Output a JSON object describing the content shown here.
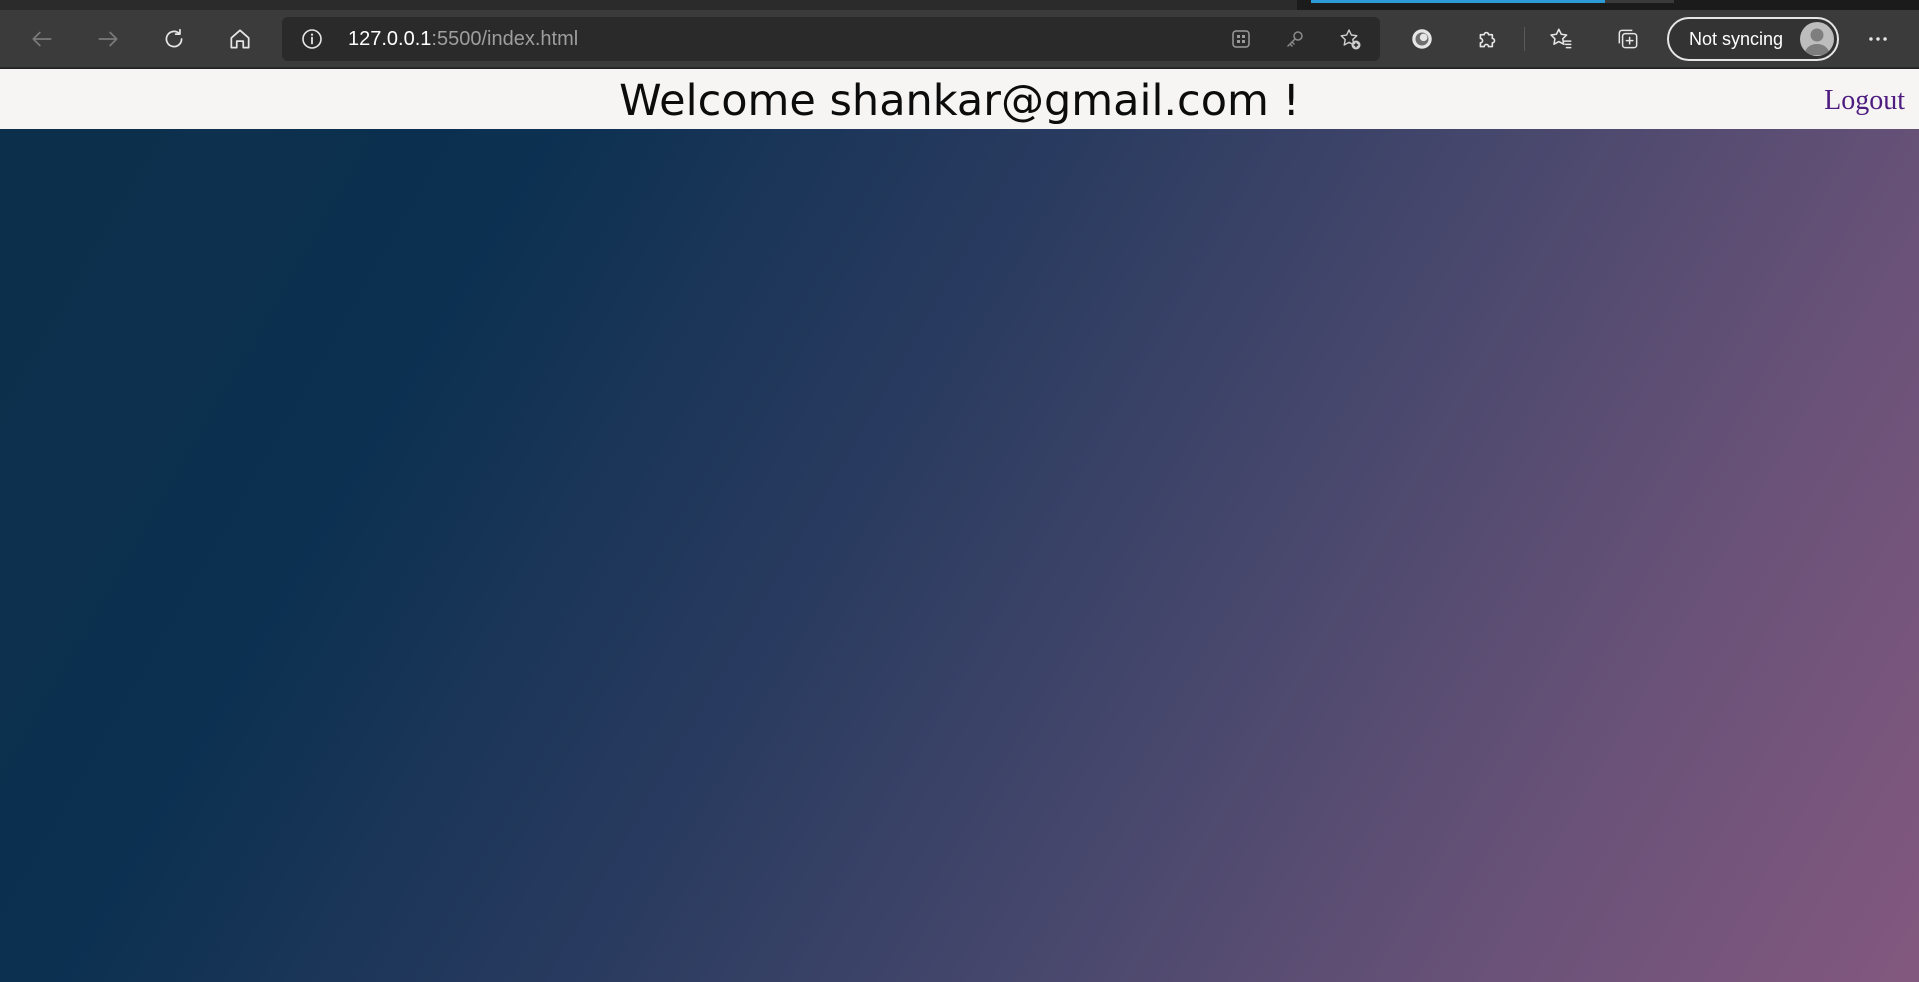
{
  "browser": {
    "url_host": "127.0.0.1",
    "url_path": ":5500/index.html",
    "sync_label": "Not syncing",
    "icons": {
      "back": "back-arrow-icon",
      "forward": "forward-arrow-icon",
      "refresh": "refresh-icon",
      "home": "home-icon",
      "info": "info-icon",
      "apps": "apps-grid-icon",
      "key": "key-icon",
      "add_favorite": "add-favorite-star-icon",
      "extension_circle": "extension-circle-icon",
      "extensions": "puzzle-icon",
      "favorites": "favorites-icon",
      "collections": "collections-icon",
      "avatar": "avatar-icon",
      "more": "more-dots-icon"
    }
  },
  "page": {
    "welcome_text": "Welcome shankar@gmail.com !",
    "logout_label": "Logout",
    "colors": {
      "header_bg": "#f6f5f3",
      "gradient_start": "#0b3050",
      "gradient_end": "#83587f",
      "logout": "#4e1c80"
    }
  }
}
